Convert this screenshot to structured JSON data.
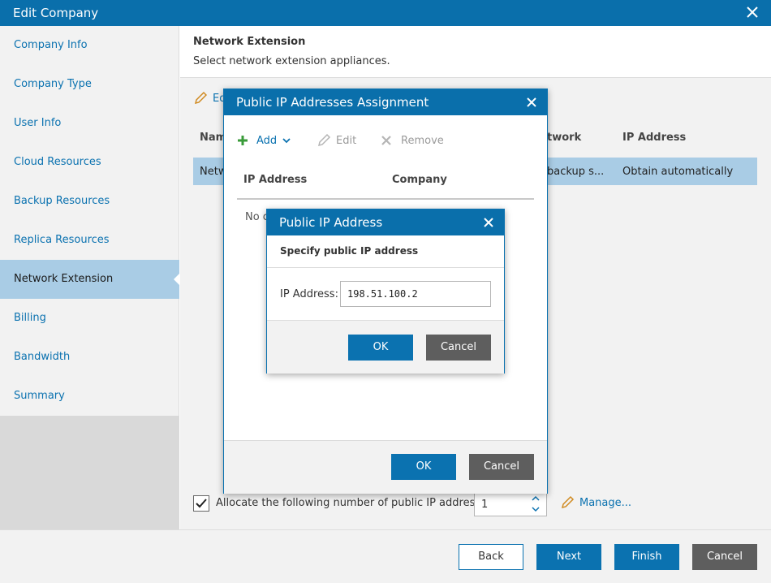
{
  "window": {
    "title": "Edit Company"
  },
  "sidebar": {
    "items": [
      {
        "label": "Company Info"
      },
      {
        "label": "Company Type"
      },
      {
        "label": "User Info"
      },
      {
        "label": "Cloud Resources"
      },
      {
        "label": "Backup Resources"
      },
      {
        "label": "Replica Resources"
      },
      {
        "label": "Network Extension"
      },
      {
        "label": "Billing"
      },
      {
        "label": "Bandwidth"
      },
      {
        "label": "Summary"
      }
    ],
    "active_index": 6
  },
  "content": {
    "title": "Network Extension",
    "subtitle": "Select network extension appliances.",
    "edit_label": "Ed",
    "table": {
      "headers": [
        "Nam",
        "twork",
        "IP Address"
      ],
      "row": [
        "Netw",
        "backup s...",
        "Obtain automatically"
      ]
    },
    "allocate": {
      "label": "Allocate the following number of public IP addresses",
      "checked": true,
      "value": "1",
      "manage_label": "Manage..."
    }
  },
  "footer": {
    "back": "Back",
    "next": "Next",
    "finish": "Finish",
    "cancel": "Cancel"
  },
  "assignment_dialog": {
    "title": "Public IP Addresses Assignment",
    "toolbar": {
      "add": "Add",
      "edit": "Edit",
      "remove": "Remove"
    },
    "headers": [
      "IP Address",
      "Company"
    ],
    "empty_text": "No c",
    "ok": "OK",
    "cancel": "Cancel"
  },
  "ip_dialog": {
    "title": "Public IP Address",
    "subtitle": "Specify public IP address",
    "field_label": "IP Address:",
    "field_value": "198.51.100.2",
    "ok": "OK",
    "cancel": "Cancel"
  },
  "colors": {
    "accent": "#0b72b0",
    "titlebar": "#0a6fab",
    "selection": "#a9cce5",
    "add_green": "#3a9b3a"
  },
  "icons": {
    "close": "close-icon",
    "pencil": "pencil-icon",
    "plus": "plus-icon",
    "remove": "x-icon",
    "chevron": "chevron-down-icon",
    "check": "check-icon"
  }
}
